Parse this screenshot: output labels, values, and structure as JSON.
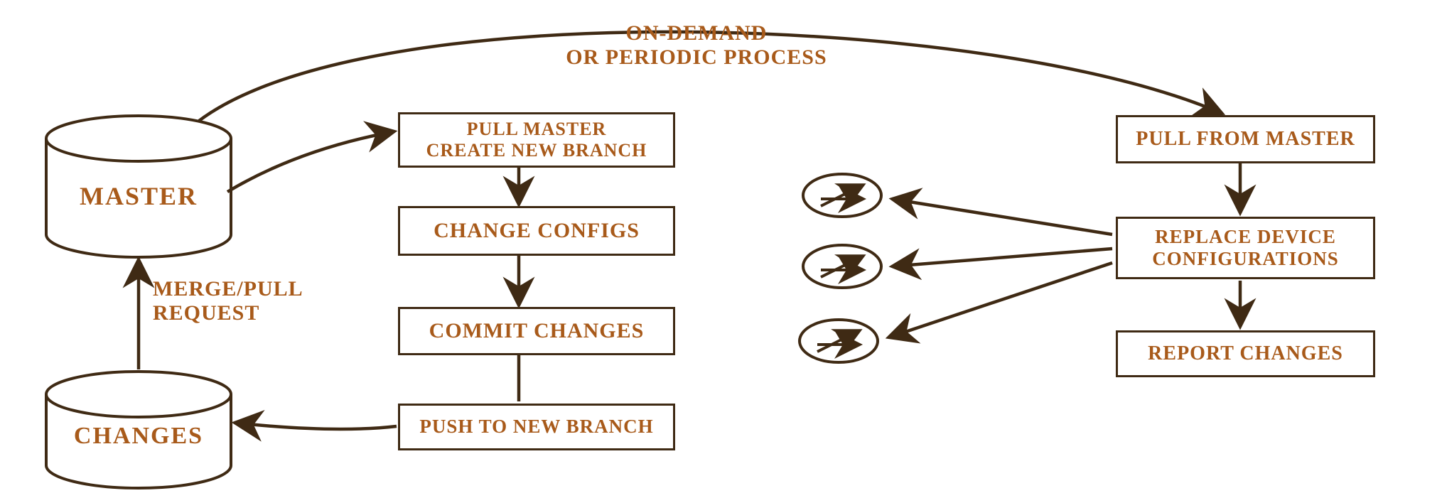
{
  "cylinders": {
    "master": "MASTER",
    "changes": "CHANGES"
  },
  "center_flow": {
    "step1": "PULL MASTER\nCREATE NEW BRANCH",
    "step2": "CHANGE CONFIGS",
    "step3": "COMMIT CHANGES",
    "step4": "PUSH TO NEW BRANCH"
  },
  "right_flow": {
    "step1": "PULL FROM MASTER",
    "step2": "REPLACE DEVICE CONFIGURATIONS",
    "step3": "REPORT CHANGES"
  },
  "labels": {
    "merge": "MERGE/PULL\nREQUEST",
    "process": "ON-DEMAND\nOR PERIODIC PROCESS"
  }
}
